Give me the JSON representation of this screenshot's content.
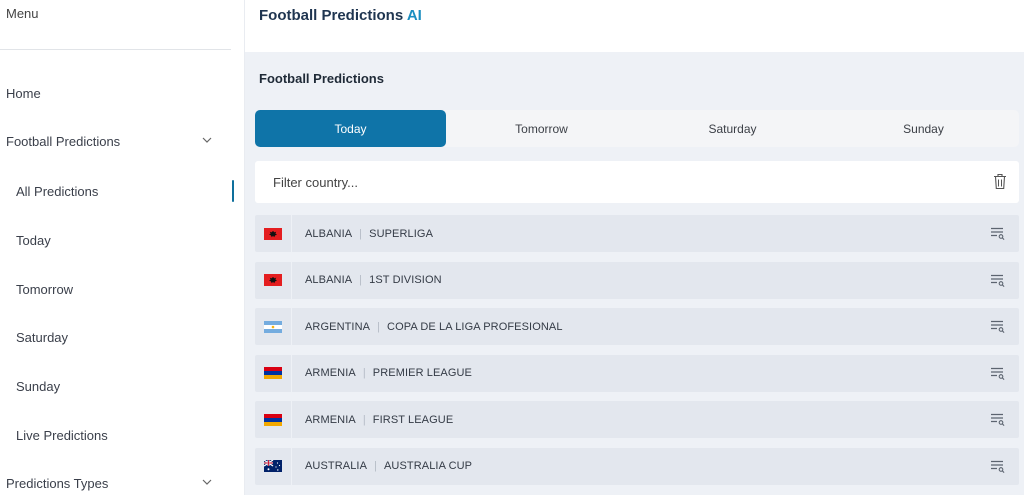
{
  "sidebar": {
    "menu_title": "Menu",
    "items": [
      {
        "label": "Home"
      },
      {
        "label": "Football Predictions"
      },
      {
        "label": "All Predictions"
      },
      {
        "label": "Today"
      },
      {
        "label": "Tomorrow"
      },
      {
        "label": "Saturday"
      },
      {
        "label": "Sunday"
      },
      {
        "label": "Live Predictions"
      },
      {
        "label": "Predictions Types"
      }
    ]
  },
  "header": {
    "brand_main": "Football Predictions",
    "brand_accent": "AI"
  },
  "main": {
    "section_title": "Football Predictions",
    "tabs": [
      {
        "label": "Today",
        "active": true
      },
      {
        "label": "Tomorrow",
        "active": false
      },
      {
        "label": "Saturday",
        "active": false
      },
      {
        "label": "Sunday",
        "active": false
      }
    ],
    "filter": {
      "placeholder": "Filter country...",
      "value": ""
    },
    "leagues": [
      {
        "country": "ALBANIA",
        "league": "SUPERLIGA",
        "flag": "albania-flag-icon"
      },
      {
        "country": "ALBANIA",
        "league": "1ST DIVISION",
        "flag": "albania-flag-icon"
      },
      {
        "country": "ARGENTINA",
        "league": "COPA DE LA LIGA PROFESIONAL",
        "flag": "argentina-flag-icon"
      },
      {
        "country": "ARMENIA",
        "league": "PREMIER LEAGUE",
        "flag": "armenia-flag-icon"
      },
      {
        "country": "ARMENIA",
        "league": "FIRST LEAGUE",
        "flag": "armenia-flag-icon"
      },
      {
        "country": "AUSTRALIA",
        "league": "AUSTRALIA CUP",
        "flag": "australia-flag-icon"
      }
    ]
  },
  "colors": {
    "accent": "#0f74a8",
    "brand_accent": "#1b8ec0",
    "main_bg": "#eef1f6",
    "row_bg": "#e3e7ee"
  }
}
